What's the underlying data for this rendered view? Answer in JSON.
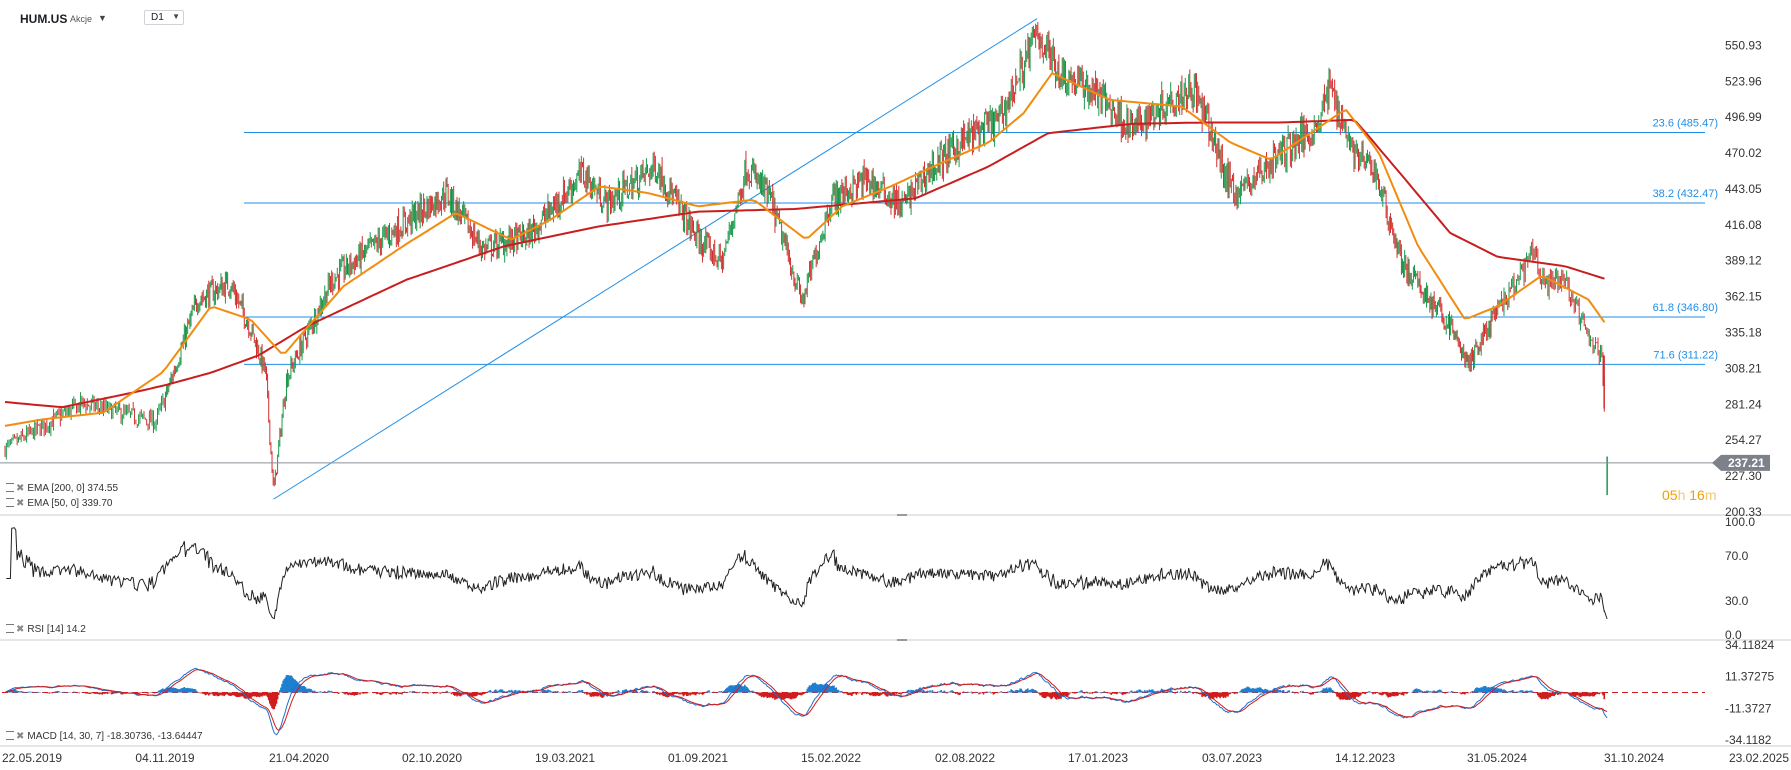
{
  "header": {
    "symbol": "HUM.US",
    "instrument_type": "Akcje",
    "timeframe": "D1"
  },
  "legends": {
    "ema200": "EMA [200, 0] 374.55",
    "ema50": "EMA [50, 0] 339.70",
    "rsi": "RSI [14] 14.2",
    "macd": "MACD [14, 30, 7] -18.30736, -13.64447"
  },
  "countdown": {
    "hours": "05",
    "h": "h",
    "minutes": "16",
    "m": "m"
  },
  "colors": {
    "candle_up": "#1a9a4b",
    "candle_down": "#d32f2f",
    "ema200": "#c81e1e",
    "ema50": "#f28c10",
    "fib_line": "#1f8ee8",
    "trend_line": "#1f8ee8",
    "price_line": "#8a8f96",
    "rsi_line": "#222222",
    "macd_hist_pos": "#1f7fd0",
    "macd_hist_neg": "#d01c1c"
  },
  "chart_data": [
    {
      "type": "candlestick",
      "name": "price",
      "y_ticks": [
        "550.93",
        "523.96",
        "496.99",
        "470.02",
        "443.05",
        "416.08",
        "389.12",
        "362.15",
        "335.18",
        "308.21",
        "281.24",
        "254.27",
        "227.30",
        "200.33"
      ],
      "ylim": [
        200.33,
        570
      ],
      "last_price": "237.21",
      "fib_levels": [
        {
          "label": "23.6 (485.47)",
          "value": 485.47
        },
        {
          "label": "38.2 (432.47)",
          "value": 432.47
        },
        {
          "label": "61.8 (346.80)",
          "value": 346.8
        },
        {
          "label": "71.6 (311.22)",
          "value": 311.22
        }
      ],
      "trend_line": {
        "from": {
          "date": "2020-03-20",
          "value": 210
        },
        "to": {
          "date": "2022-11-01",
          "value": 571
        }
      },
      "price_path": [
        [
          "2019-05-22",
          248
        ],
        [
          "2019-08-10",
          282
        ],
        [
          "2019-10-25",
          268
        ],
        [
          "2019-12-15",
          360
        ],
        [
          "2020-01-25",
          372
        ],
        [
          "2020-02-20",
          338
        ],
        [
          "2020-03-10",
          305
        ],
        [
          "2020-03-20",
          215
        ],
        [
          "2020-04-05",
          300
        ],
        [
          "2020-06-01",
          375
        ],
        [
          "2020-08-01",
          405
        ],
        [
          "2020-10-20",
          440
        ],
        [
          "2020-12-05",
          398
        ],
        [
          "2021-02-01",
          408
        ],
        [
          "2021-04-10",
          455
        ],
        [
          "2021-05-10",
          432
        ],
        [
          "2021-07-10",
          460
        ],
        [
          "2021-09-01",
          405
        ],
        [
          "2021-10-01",
          388
        ],
        [
          "2021-11-01",
          460
        ],
        [
          "2021-12-01",
          435
        ],
        [
          "2022-01-10",
          358
        ],
        [
          "2022-02-15",
          435
        ],
        [
          "2022-04-01",
          450
        ],
        [
          "2022-05-15",
          430
        ],
        [
          "2022-06-15",
          455
        ],
        [
          "2022-08-01",
          480
        ],
        [
          "2022-09-15",
          495
        ],
        [
          "2022-10-10",
          530
        ],
        [
          "2022-11-01",
          560
        ],
        [
          "2022-12-01",
          530
        ],
        [
          "2023-01-15",
          515
        ],
        [
          "2023-03-01",
          488
        ],
        [
          "2023-04-15",
          510
        ],
        [
          "2023-05-15",
          520
        ],
        [
          "2023-06-10",
          480
        ],
        [
          "2023-06-25",
          452
        ],
        [
          "2023-07-10",
          440
        ],
        [
          "2023-09-01",
          470
        ],
        [
          "2023-10-15",
          490
        ],
        [
          "2023-11-01",
          520
        ],
        [
          "2023-12-01",
          470
        ],
        [
          "2023-12-28",
          455
        ],
        [
          "2024-01-20",
          408
        ],
        [
          "2024-02-01",
          385
        ],
        [
          "2024-04-01",
          340
        ],
        [
          "2024-04-25",
          310
        ],
        [
          "2024-05-15",
          335
        ],
        [
          "2024-06-15",
          365
        ],
        [
          "2024-07-10",
          395
        ],
        [
          "2024-07-25",
          370
        ],
        [
          "2024-08-15",
          375
        ],
        [
          "2024-09-10",
          330
        ],
        [
          "2024-09-25",
          318
        ],
        [
          "2024-10-01",
          237
        ]
      ],
      "ema200_path": [
        [
          "2019-05-22",
          283
        ],
        [
          "2019-07-20",
          279
        ],
        [
          "2019-10-01",
          290
        ],
        [
          "2020-01-01",
          305
        ],
        [
          "2020-03-01",
          318
        ],
        [
          "2020-05-01",
          340
        ],
        [
          "2020-09-01",
          375
        ],
        [
          "2021-01-01",
          400
        ],
        [
          "2021-05-01",
          415
        ],
        [
          "2021-09-01",
          426
        ],
        [
          "2022-01-01",
          428
        ],
        [
          "2022-06-01",
          436
        ],
        [
          "2022-09-01",
          460
        ],
        [
          "2022-11-15",
          485
        ],
        [
          "2023-03-01",
          492
        ],
        [
          "2023-06-01",
          493
        ],
        [
          "2023-09-01",
          493
        ],
        [
          "2023-12-01",
          495
        ],
        [
          "2024-02-01",
          452
        ],
        [
          "2024-04-01",
          410
        ],
        [
          "2024-06-01",
          392
        ],
        [
          "2024-08-15",
          385
        ],
        [
          "2024-10-01",
          375
        ]
      ],
      "ema50_path": [
        [
          "2019-05-22",
          265
        ],
        [
          "2019-07-01",
          270
        ],
        [
          "2019-09-01",
          275
        ],
        [
          "2019-11-01",
          305
        ],
        [
          "2020-01-01",
          355
        ],
        [
          "2020-02-20",
          345
        ],
        [
          "2020-04-01",
          318
        ],
        [
          "2020-06-15",
          370
        ],
        [
          "2020-09-01",
          402
        ],
        [
          "2020-11-01",
          425
        ],
        [
          "2021-01-10",
          405
        ],
        [
          "2021-03-01",
          420
        ],
        [
          "2021-05-01",
          445
        ],
        [
          "2021-07-01",
          440
        ],
        [
          "2021-09-01",
          430
        ],
        [
          "2021-11-10",
          435
        ],
        [
          "2022-01-15",
          405
        ],
        [
          "2022-03-01",
          430
        ],
        [
          "2022-05-01",
          445
        ],
        [
          "2022-07-01",
          462
        ],
        [
          "2022-09-01",
          478
        ],
        [
          "2022-10-15",
          500
        ],
        [
          "2022-11-20",
          530
        ],
        [
          "2023-02-01",
          510
        ],
        [
          "2023-05-01",
          505
        ],
        [
          "2023-07-01",
          478
        ],
        [
          "2023-08-20",
          465
        ],
        [
          "2023-10-15",
          488
        ],
        [
          "2023-11-20",
          503
        ],
        [
          "2024-01-01",
          470
        ],
        [
          "2024-02-20",
          400
        ],
        [
          "2024-04-20",
          345
        ],
        [
          "2024-06-01",
          355
        ],
        [
          "2024-07-20",
          378
        ],
        [
          "2024-09-10",
          360
        ],
        [
          "2024-10-01",
          340
        ]
      ]
    },
    {
      "type": "line",
      "name": "RSI [14]",
      "y_ticks": [
        "100.0",
        "70.0",
        "30.0",
        "0.0"
      ],
      "ylim": [
        0,
        100
      ],
      "last_value": 14.2
    },
    {
      "type": "histogram",
      "name": "MACD [14, 30, 7]",
      "y_ticks": [
        "34.11824",
        "11.37275",
        "-11.3727",
        "-34.1182"
      ],
      "ylim": [
        -34.1182,
        34.11824
      ],
      "last_values": [
        -18.30736,
        -13.64447
      ]
    }
  ],
  "x_axis": {
    "ticks": [
      "22.05.2019",
      "04.11.2019",
      "21.04.2020",
      "02.10.2020",
      "19.03.2021",
      "01.09.2021",
      "15.02.2022",
      "02.08.2022",
      "17.01.2023",
      "03.07.2023",
      "14.12.2023",
      "31.05.2024",
      "31.10.2024",
      "23.02.2025"
    ],
    "first_date": "2019-05-22",
    "last_date": "2025-02-23"
  }
}
